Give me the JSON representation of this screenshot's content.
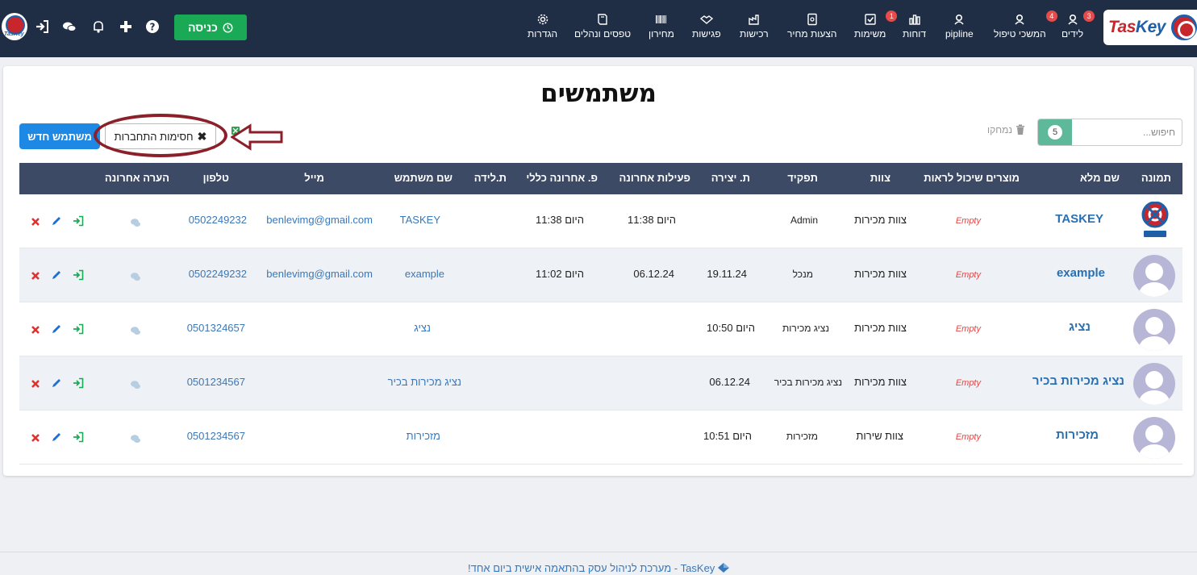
{
  "brand": {
    "logo_text_a": "Tas",
    "logo_text_b": "Key",
    "avatar_text": "TasKey"
  },
  "nav": {
    "items": [
      {
        "label": "לידים",
        "badge": "3",
        "icon": "user-icon"
      },
      {
        "label": "המשכי טיפול",
        "badge": "4",
        "icon": "user-icon"
      },
      {
        "label": "pipline",
        "badge": "",
        "icon": "user-icon"
      },
      {
        "label": "דוחות",
        "badge": "",
        "icon": "bar-chart-icon"
      },
      {
        "label": "משימות",
        "badge": "1",
        "icon": "checkbox-icon"
      },
      {
        "label": "הצעות מחיר",
        "badge": "",
        "icon": "document-icon"
      },
      {
        "label": "רכישות",
        "badge": "",
        "icon": "factory-icon"
      },
      {
        "label": "פגישות",
        "badge": "",
        "icon": "handshake-icon"
      },
      {
        "label": "מחירון",
        "badge": "",
        "icon": "barcode-icon"
      },
      {
        "label": "טפסים ונהלים",
        "badge": "",
        "icon": "book-icon"
      },
      {
        "label": "הגדרות",
        "badge": "",
        "icon": "gear-icon"
      }
    ],
    "enter_label": "כניסה"
  },
  "page": {
    "title": "משתמשים",
    "search_placeholder": "חיפוש...",
    "search_count": "5",
    "deleted_label": "נמחקו",
    "new_user_label": "משתמש חדש",
    "blocks_label": "חסימות התחברות"
  },
  "table": {
    "headers": {
      "photo": "תמונה",
      "fullname": "שם מלא",
      "products": "מוצרים שיכול לראות",
      "team": "צוות",
      "role": "תפקיד",
      "created": "ת. יצירה",
      "last_activity": "פעילות אחרונה",
      "last_action": "פ. אחרונה כללי",
      "birth": "ת.לידה",
      "username": "שם משתמש",
      "email": "מייל",
      "phone": "טלפון",
      "last_note": "הערה אחרונה"
    },
    "rows": [
      {
        "fullname": "TASKEY",
        "products": "Empty",
        "team": "צוות מכירות",
        "role": "Admin",
        "created": "",
        "last_activity": "היום 11:38",
        "last_action": "היום 11:38",
        "username": "TASKEY",
        "email": "benlevimg@gmail.com",
        "phone": "0502249232"
      },
      {
        "fullname": "example",
        "products": "Empty",
        "team": "צוות מכירות",
        "role": "מנכל",
        "created": "19.11.24",
        "last_activity": "06.12.24",
        "last_action": "היום 11:02",
        "username": "example",
        "email": "benlevimg@gmail.com",
        "phone": "0502249232"
      },
      {
        "fullname": "נציג",
        "products": "Empty",
        "team": "צוות מכירות",
        "role": "נציג מכירות",
        "created": "היום 10:50",
        "last_activity": "",
        "last_action": "",
        "username": "נציג",
        "email": "",
        "phone": "0501324657"
      },
      {
        "fullname": "נציג מכירות בכיר",
        "products": "Empty",
        "team": "צוות מכירות",
        "role": "נציג מכירות בכיר",
        "created": "06.12.24",
        "last_activity": "",
        "last_action": "",
        "username": "נציג מכירות בכיר",
        "email": "",
        "phone": "0501234567"
      },
      {
        "fullname": "מזכירות",
        "products": "Empty",
        "team": "צוות שירות",
        "role": "מזכירות",
        "created": "היום 10:51",
        "last_activity": "",
        "last_action": "",
        "username": "מזכירות",
        "email": "",
        "phone": "0501234567"
      }
    ]
  },
  "footer": {
    "text": "TasKey - מערכת לניהול עסק בהתאמה אישית ביום אחד!"
  },
  "colors": {
    "nav_bg": "#1f2d45",
    "accent_green": "#1aaa55",
    "primary_blue": "#1e88e5",
    "header_bg": "#3d4a66",
    "highlight_ellipse": "#8b1f2a"
  }
}
